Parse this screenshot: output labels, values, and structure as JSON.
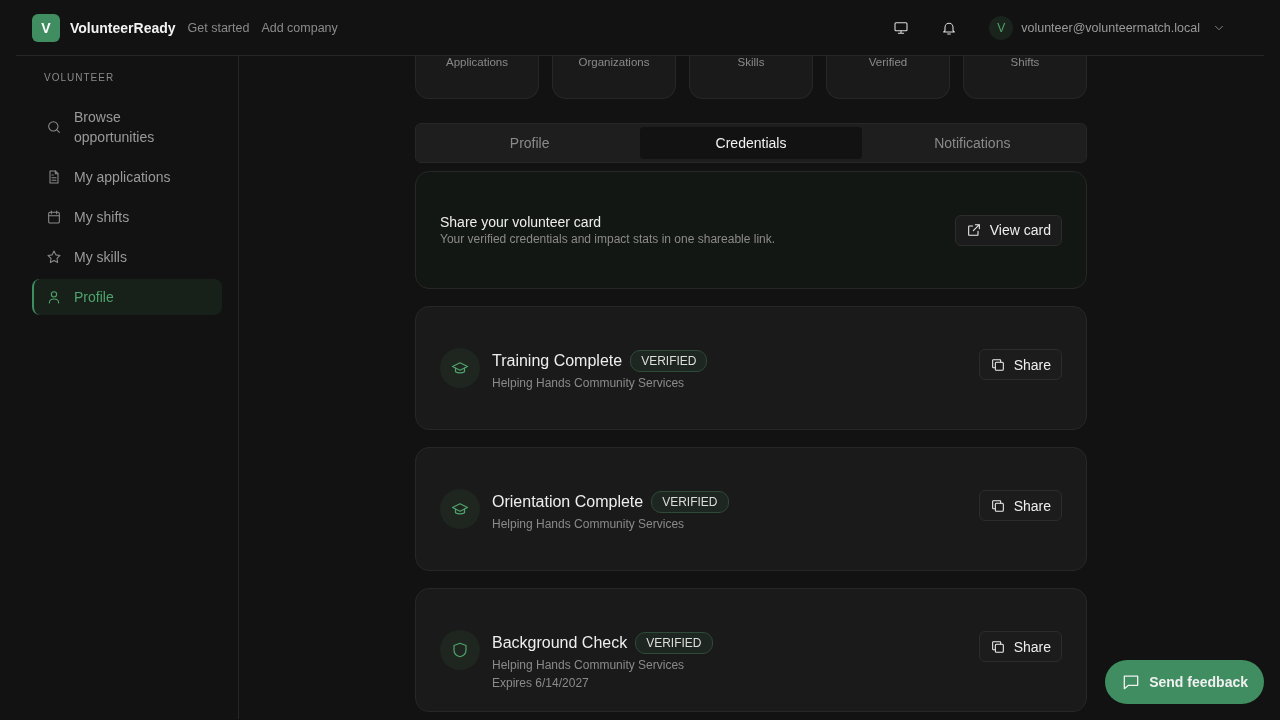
{
  "header": {
    "logo_letter": "V",
    "brand": "VolunteerReady",
    "links": [
      "Get started",
      "Add company"
    ],
    "avatar_letter": "V",
    "email": "volunteer@volunteermatch.local"
  },
  "sidebar": {
    "section": "VOLUNTEER",
    "items": [
      {
        "label": "Browse opportunities",
        "kind": "search",
        "selected": false
      },
      {
        "label": "My applications",
        "kind": "document",
        "selected": false
      },
      {
        "label": "My shifts",
        "kind": "calendar",
        "selected": false
      },
      {
        "label": "My skills",
        "kind": "star",
        "selected": false
      },
      {
        "label": "Profile",
        "kind": "person",
        "selected": true
      }
    ]
  },
  "stats": [
    "Applications",
    "Organizations",
    "Skills",
    "Verified",
    "Shifts"
  ],
  "tabs": [
    {
      "label": "Profile",
      "selected": false
    },
    {
      "label": "Credentials",
      "selected": true
    },
    {
      "label": "Notifications",
      "selected": false
    }
  ],
  "share_card": {
    "title": "Share your volunteer card",
    "description": "Your verified credentials and impact stats in one shareable link.",
    "button": "View card"
  },
  "credentials": [
    {
      "kind": "training",
      "title": "Training Complete",
      "badge": "VERIFIED",
      "organization": "Helping Hands Community Services",
      "button": "Share"
    },
    {
      "kind": "training",
      "title": "Orientation Complete",
      "badge": "VERIFIED",
      "organization": "Helping Hands Community Services",
      "button": "Share"
    },
    {
      "kind": "check",
      "title": "Background Check",
      "badge": "VERIFIED",
      "organization": "Helping Hands Community Services",
      "expires": "Expires 6/14/2027",
      "button": "Share"
    }
  ],
  "feedback_button": "Send feedback"
}
